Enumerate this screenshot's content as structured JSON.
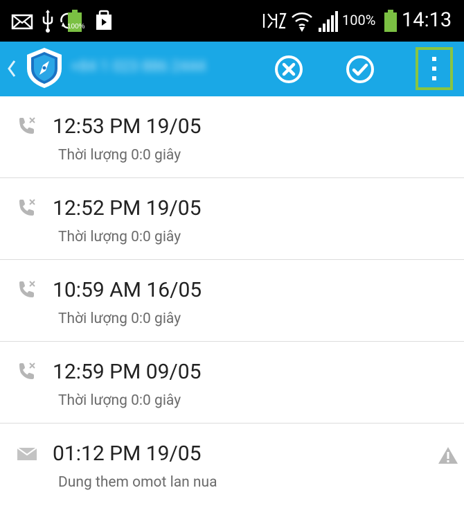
{
  "status_bar": {
    "battery_small_label": "100%",
    "battery_percent": "100%",
    "time": "14:13"
  },
  "action_bar": {
    "title": "+84 1 023 886 2444"
  },
  "list": [
    {
      "type": "call",
      "title": "12:53 PM 19/05",
      "subtitle": "Thời lượng 0:0 giây"
    },
    {
      "type": "call",
      "title": "12:52 PM 19/05",
      "subtitle": "Thời lượng 0:0 giây"
    },
    {
      "type": "call",
      "title": "10:59 AM 16/05",
      "subtitle": "Thời lượng 0:0 giây"
    },
    {
      "type": "call",
      "title": "12:59 PM 09/05",
      "subtitle": "Thời lượng 0:0 giây"
    },
    {
      "type": "sms",
      "title": "01:12 PM 19/05",
      "subtitle": "Dung them omot lan nua",
      "warning": true
    }
  ],
  "colors": {
    "action_bar": "#1aa8e6",
    "highlight_border": "#89c541",
    "icon_gray": "#b6b6b6",
    "subtitle": "#6b6b6b"
  }
}
